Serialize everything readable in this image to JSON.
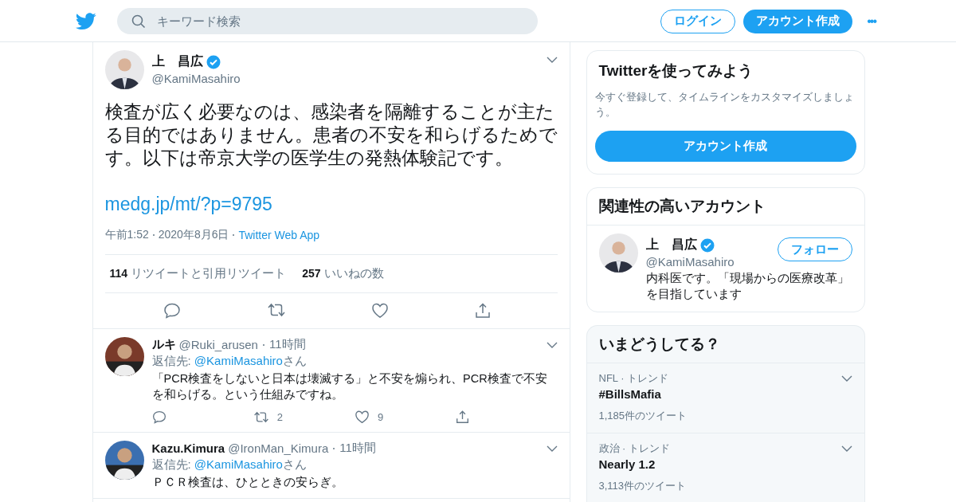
{
  "header": {
    "search": {
      "placeholder": "キーワード検索"
    },
    "login": "ログイン",
    "signup": "アカウント作成",
    "more": "•••"
  },
  "tweet": {
    "name": "上　昌広",
    "verified": true,
    "handle": "@KamiMasahiro",
    "text": "検査が広く必要なのは、感染者を隔離することが主たる目的ではありません。患者の不安を和らげるためです。以下は帝京大学の医学生の発熱体験記です。",
    "link": "medg.jp/mt/?p=9795",
    "time": "午前1:52",
    "date": "2020年8月6日",
    "source": "Twitter Web App",
    "retweets": "114",
    "retweets_label": "リツイートと引用リツイート",
    "likes": "257",
    "likes_label": "いいねの数"
  },
  "replies": [
    {
      "name": "ルキ",
      "handle": "@Ruki_arusen",
      "age": "11時間",
      "reply_to_label": "返信先:",
      "reply_to": "@KamiMasahiro",
      "reply_to_suffix": "さん",
      "text": "「PCR検査をしないと日本は壊滅する」と不安を煽られ、PCR検査で不安を和らげる。という仕組みですね。",
      "retweets": "2",
      "likes": "9"
    },
    {
      "name": "Kazu.Kimura",
      "handle": "@IronMan_Kimura",
      "age": "11時間",
      "reply_to_label": "返信先:",
      "reply_to": "@KamiMasahiro",
      "reply_to_suffix": "さん",
      "text": "ＰＣＲ検査は、ひとときの安らぎ。"
    }
  ],
  "signup_card": {
    "title": "Twitterを使ってみよう",
    "subtitle": "今すぐ登録して、タイムラインをカスタマイズしましょう。",
    "button": "アカウント作成"
  },
  "related": {
    "title": "関連性の高いアカウント",
    "accounts": [
      {
        "name": "上　昌広",
        "verified": true,
        "handle": "@KamiMasahiro",
        "bio": "内科医です。「現場からの医療改革」を目指しています",
        "follow": "フォロー"
      }
    ]
  },
  "trends": {
    "title": "いまどうしてる？",
    "items": [
      {
        "context": "NFL · トレンド",
        "topic": "#BillsMafia",
        "count": "1,185件のツイート"
      },
      {
        "context": "政治 · トレンド",
        "topic": "Nearly 1.2",
        "count": "3,113件のツイート"
      }
    ]
  }
}
